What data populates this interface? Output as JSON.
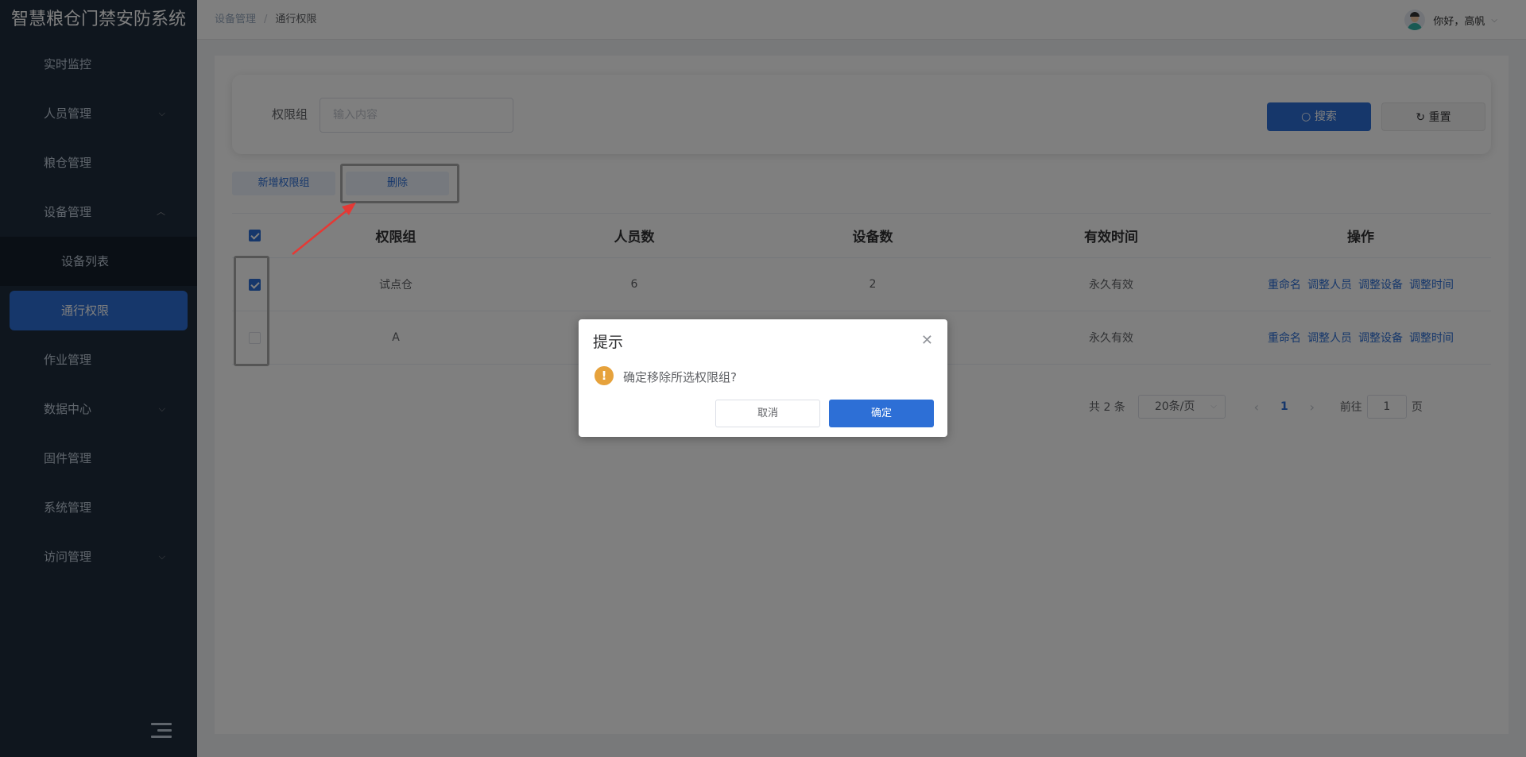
{
  "app": {
    "title": "智慧粮仓门禁安防系统"
  },
  "sidebar": {
    "items": [
      {
        "label": "实时监控"
      },
      {
        "label": "人员管理",
        "arrow": "⌵"
      },
      {
        "label": "粮仓管理"
      },
      {
        "label": "设备管理",
        "arrow": "︿"
      },
      {
        "label": "设备列表"
      },
      {
        "label": "通行权限"
      },
      {
        "label": "作业管理"
      },
      {
        "label": "数据中心",
        "arrow": "⌵"
      },
      {
        "label": "固件管理"
      },
      {
        "label": "系统管理"
      },
      {
        "label": "访问管理",
        "arrow": "⌵"
      }
    ]
  },
  "header": {
    "breadcrumb": [
      "设备管理",
      "/",
      "通行权限"
    ],
    "user_greeting": "你好，高帆",
    "user_chevron": "⌵"
  },
  "search": {
    "label": "权限组",
    "placeholder": "输入内容",
    "search_button": "搜索",
    "search_icon_glyph": "○",
    "reset_button": "重置",
    "reset_icon_glyph": "↻"
  },
  "toolbar": {
    "add_label": "新增权限组",
    "delete_label": "删除"
  },
  "table": {
    "headers": [
      "权限组",
      "人员数",
      "设备数",
      "有效时间",
      "操作"
    ],
    "rows": [
      {
        "group": "试点仓",
        "people": "6",
        "devices": "2",
        "time": "永久有效",
        "checked": true
      },
      {
        "group": "A",
        "people": "",
        "devices": "",
        "time": "永久有效",
        "checked": false
      }
    ],
    "ops": [
      "重命名",
      "调整人员",
      "调整设备",
      "调整时间"
    ]
  },
  "pagination": {
    "total": "共 2 条",
    "page_size": "20条/页",
    "prev": "‹",
    "current": "1",
    "next": "›",
    "goto_prefix": "前往",
    "goto_value": "1",
    "goto_suffix": "页"
  },
  "dialog": {
    "title": "提示",
    "close": "✕",
    "icon": "!",
    "message": "确定移除所选权限组?",
    "cancel": "取消",
    "confirm": "确定"
  },
  "colors": {
    "primary": "#2d6fd6",
    "sidebar_bg": "#1f2d3d",
    "warning": "#e6a23c",
    "annotation_arrow": "#e53935"
  }
}
